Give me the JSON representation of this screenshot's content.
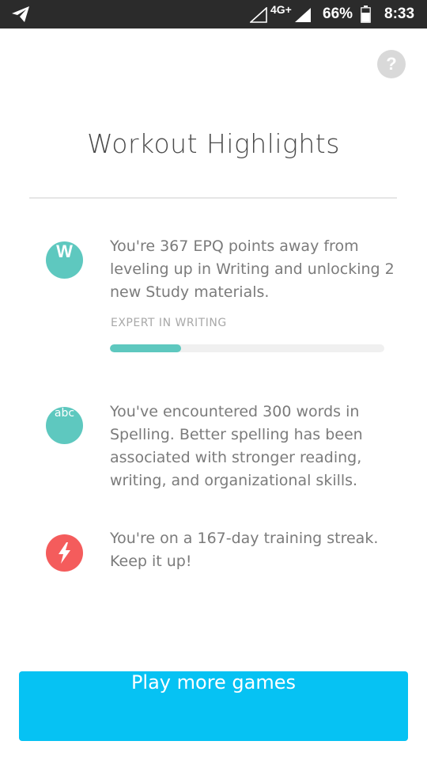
{
  "status_bar": {
    "network": "4G+",
    "battery_percent": "66%",
    "time": "8:33"
  },
  "icons": {
    "help": "?",
    "w": "W",
    "abc": "abc"
  },
  "title": "Workout Highlights",
  "highlights": [
    {
      "text": "You're 367 EPQ points away from leveling up in Writing and unlocking 2 new Study materials.",
      "skill_label": "EXPERT IN WRITING",
      "progress": 0.26
    },
    {
      "text": "You've encountered 300 words in Spelling. Better spelling has been associated with stronger reading, writing, and organizational skills."
    },
    {
      "text": "You're on a 167-day training streak. Keep it up!"
    }
  ],
  "play_button": "Play more games",
  "colors": {
    "teal": "#5ec8bf",
    "red": "#f45c5c",
    "button": "#06c2f3",
    "status_bar": "#2b2b2b"
  }
}
